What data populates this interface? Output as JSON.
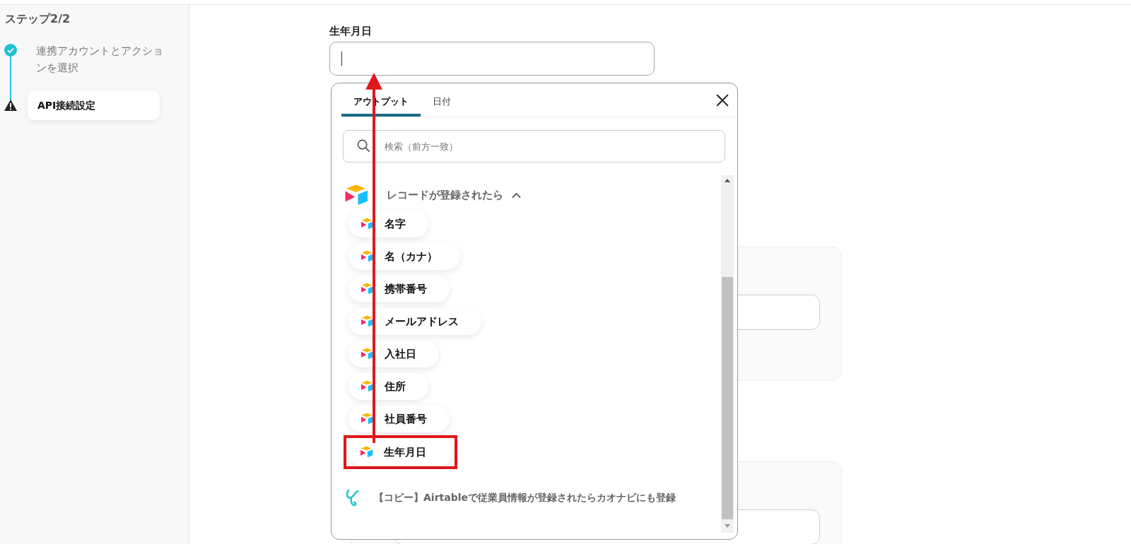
{
  "sidebar": {
    "title": "ステップ2/2",
    "steps": [
      {
        "label": "連携アカウントとアクションを選択",
        "kind": "done",
        "selected": false
      },
      {
        "label": "API接続設定",
        "kind": "warning",
        "selected": true
      }
    ]
  },
  "form": {
    "label": "生年月日"
  },
  "popup": {
    "tabs": [
      {
        "label": "アウトプット",
        "selected": true
      },
      {
        "label": "日付",
        "selected": false
      }
    ],
    "search": {
      "placeholder": "検索（前方一致）"
    },
    "group": {
      "title": "レコードが登録されたら",
      "expanded": true,
      "items": [
        {
          "label": "名字",
          "highlighted": false
        },
        {
          "label": "名（カナ）",
          "highlighted": false
        },
        {
          "label": "携帯番号",
          "highlighted": false
        },
        {
          "label": "メールアドレス",
          "highlighted": false
        },
        {
          "label": "入社日",
          "highlighted": false
        },
        {
          "label": "住所",
          "highlighted": false
        },
        {
          "label": "社員番号",
          "highlighted": false
        },
        {
          "label": "生年月日",
          "highlighted": true
        }
      ]
    },
    "footer_item": "【コピー】Airtableで従業員情報が登録されたらカオナビにも登録"
  }
}
